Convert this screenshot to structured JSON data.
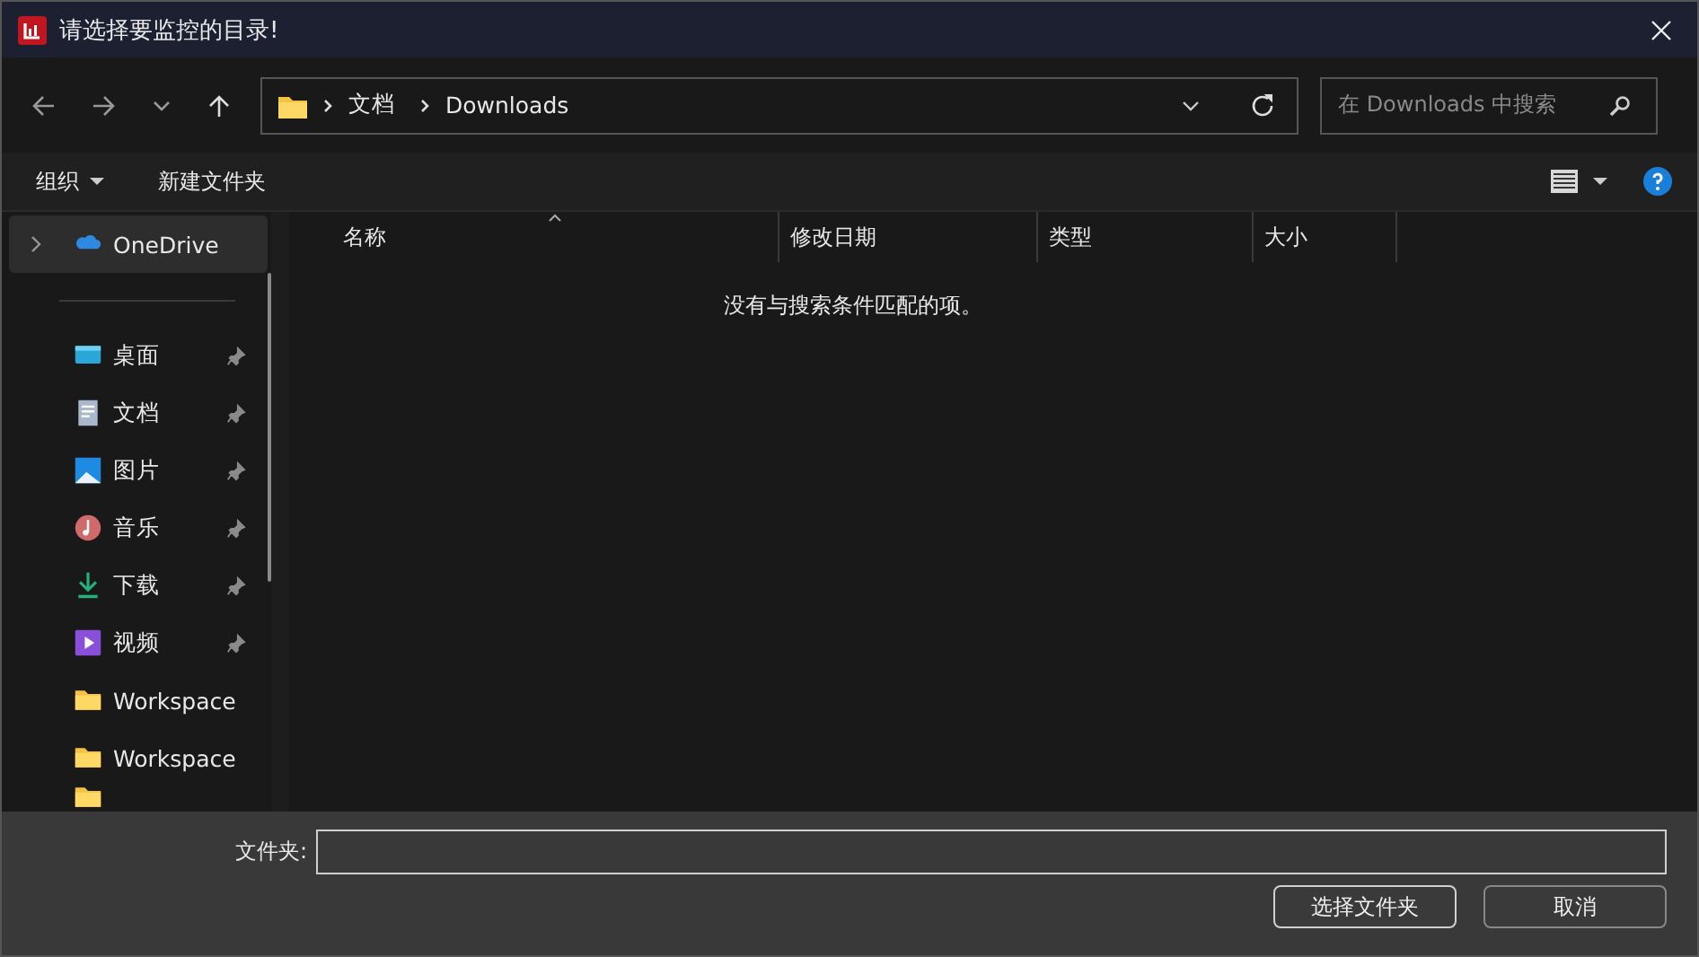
{
  "window": {
    "title": "请选择要监控的目录!"
  },
  "address": {
    "crumbs": [
      "文档",
      "Downloads"
    ]
  },
  "search": {
    "placeholder": "在 Downloads 中搜索"
  },
  "toolbar": {
    "organize": "组织",
    "new_folder": "新建文件夹"
  },
  "sidebar": {
    "items": [
      {
        "label": "OneDrive",
        "kind": "cloud",
        "selected": true,
        "pinned": false
      },
      {
        "label": "桌面",
        "kind": "desktop",
        "selected": false,
        "pinned": true
      },
      {
        "label": "文档",
        "kind": "document",
        "selected": false,
        "pinned": true
      },
      {
        "label": "图片",
        "kind": "picture",
        "selected": false,
        "pinned": true
      },
      {
        "label": "音乐",
        "kind": "music",
        "selected": false,
        "pinned": true
      },
      {
        "label": "下载",
        "kind": "download",
        "selected": false,
        "pinned": true
      },
      {
        "label": "视频",
        "kind": "video",
        "selected": false,
        "pinned": true
      },
      {
        "label": "Workspace",
        "kind": "folder",
        "selected": false,
        "pinned": false
      },
      {
        "label": "Workspace",
        "kind": "folder",
        "selected": false,
        "pinned": false
      }
    ]
  },
  "table": {
    "columns": [
      "名称",
      "修改日期",
      "类型",
      "大小"
    ],
    "empty_message": "没有与搜索条件匹配的项。"
  },
  "footer": {
    "folder_label": "文件夹:",
    "buttons": [
      {
        "label": "选择文件夹",
        "primary": true
      },
      {
        "label": "取消",
        "primary": false
      }
    ]
  }
}
